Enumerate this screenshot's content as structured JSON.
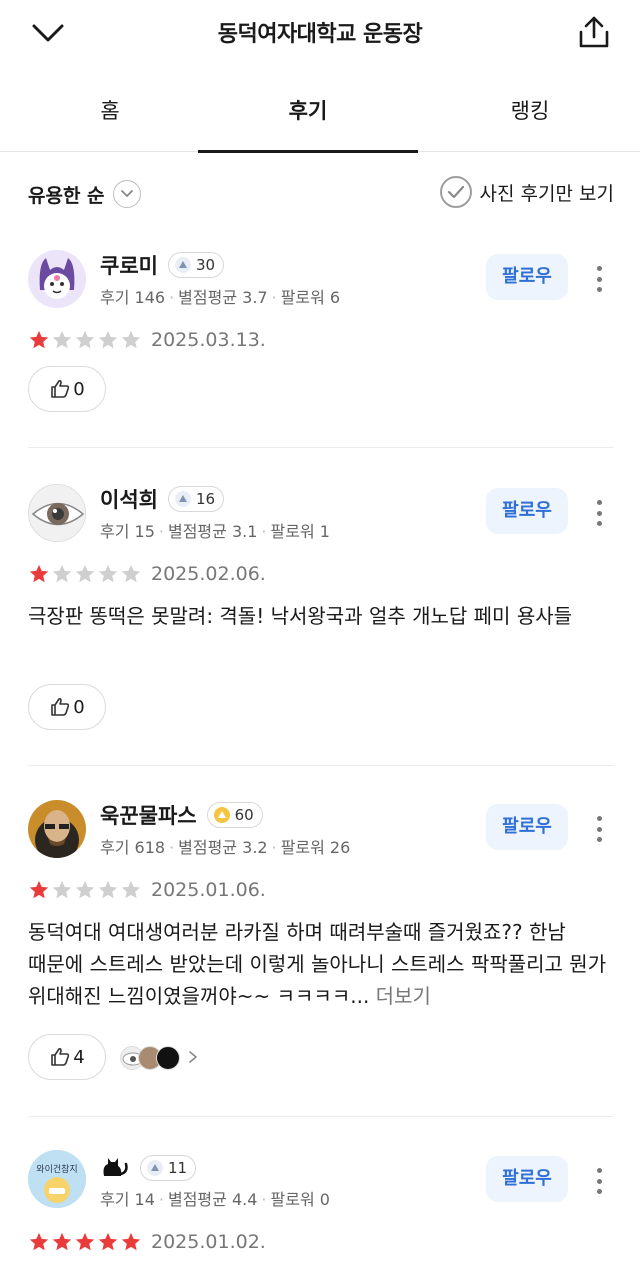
{
  "header": {
    "title": "동덕여자대학교 운동장"
  },
  "tabs": [
    {
      "label": "홈",
      "active": false
    },
    {
      "label": "후기",
      "active": true
    },
    {
      "label": "랭킹",
      "active": false
    }
  ],
  "sort": {
    "label": "유용한 순"
  },
  "photo_filter": {
    "label": "사진 후기만 보기"
  },
  "follow_label": "팔로우",
  "reviews": [
    {
      "name": "쿠로미",
      "level": "30",
      "reviews_label": "후기 146",
      "avg_label": "별점평균 3.7",
      "followers_label": "팔로워 6",
      "stars": 1,
      "date": "2025.03.13.",
      "text": "",
      "likes": "0"
    },
    {
      "name": "이석희",
      "level": "16",
      "reviews_label": "후기 15",
      "avg_label": "별점평균 3.1",
      "followers_label": "팔로워 1",
      "stars": 1,
      "date": "2025.02.06.",
      "text": "극장판 똥떡은 못말려: 격돌! 낙서왕국과 얼추 개노답 페미 용사들",
      "likes": "0"
    },
    {
      "name": "욱꾼물파스",
      "level": "60",
      "reviews_label": "후기 618",
      "avg_label": "별점평균 3.2",
      "followers_label": "팔로워 26",
      "stars": 1,
      "date": "2025.01.06.",
      "text": "동덕여대 여대생여러분 라카질 하며 때려부술때 즐거웠죠?? 한남 때문에 스트레스 받았는데 이렇게 놀아나니 스트레스 팍팍풀리고 뭔가 위대해진 느낌이였을꺼야~~ ㅋㅋㅋㅋ...",
      "more_label": "더보기",
      "likes": "4"
    },
    {
      "name": "🐈‍⬛",
      "level": "11",
      "reviews_label": "후기 14",
      "avg_label": "별점평균 4.4",
      "followers_label": "팔로워 0",
      "stars": 5,
      "date": "2025.01.02.",
      "avatar_text": "와이건참지",
      "likes": ""
    }
  ],
  "colors": {
    "star_on": "#ea3b3b",
    "star_off": "#cfcfcf",
    "follow_bg": "#eef4fd",
    "follow_text": "#2f6fd6"
  }
}
